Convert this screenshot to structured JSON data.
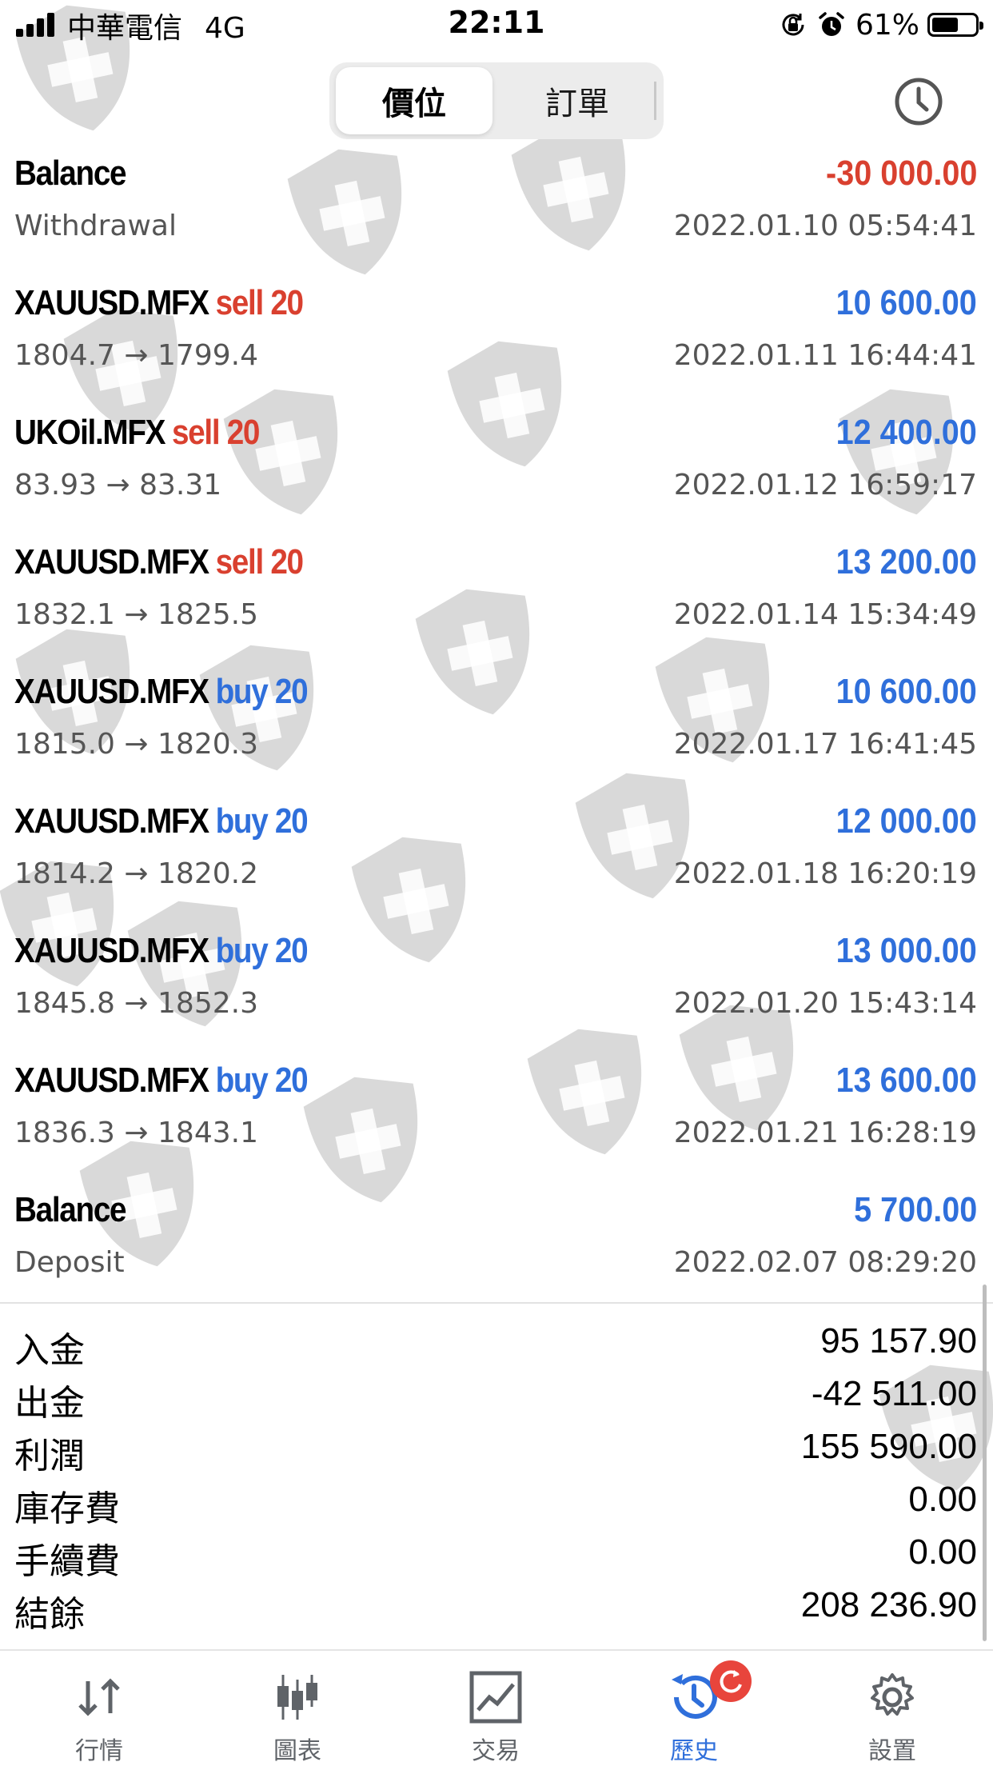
{
  "colors": {
    "loss": "#d9402f",
    "profit": "#2f6fdb",
    "neutral": "#000000"
  },
  "status_bar": {
    "carrier": "中華電信",
    "network": "4G",
    "time": "22:11",
    "battery_percent": "61%",
    "battery_level": 0.61,
    "icons": [
      "orientation-lock-icon",
      "alarm-icon"
    ]
  },
  "segment": {
    "tabs": [
      "價位",
      "訂單"
    ],
    "selected": 0
  },
  "transactions": [
    {
      "symbol": "Balance",
      "action": "",
      "amount": "-30 000.00",
      "amount_color": "loss",
      "detail": "Withdrawal",
      "time": "2022.01.10 05:54:41"
    },
    {
      "symbol": "XAUUSD.MFX",
      "action": "sell 20",
      "action_color": "loss",
      "amount": "10 600.00",
      "amount_color": "profit",
      "detail": "1804.7 → 1799.4",
      "time": "2022.01.11 16:44:41"
    },
    {
      "symbol": "UKOil.MFX",
      "action": "sell 20",
      "action_color": "loss",
      "amount": "12 400.00",
      "amount_color": "profit",
      "detail": "83.93 → 83.31",
      "time": "2022.01.12 16:59:17"
    },
    {
      "symbol": "XAUUSD.MFX",
      "action": "sell 20",
      "action_color": "loss",
      "amount": "13 200.00",
      "amount_color": "profit",
      "detail": "1832.1 → 1825.5",
      "time": "2022.01.14 15:34:49"
    },
    {
      "symbol": "XAUUSD.MFX",
      "action": "buy 20",
      "action_color": "profit",
      "amount": "10 600.00",
      "amount_color": "profit",
      "detail": "1815.0 → 1820.3",
      "time": "2022.01.17 16:41:45"
    },
    {
      "symbol": "XAUUSD.MFX",
      "action": "buy 20",
      "action_color": "profit",
      "amount": "12 000.00",
      "amount_color": "profit",
      "detail": "1814.2 → 1820.2",
      "time": "2022.01.18 16:20:19"
    },
    {
      "symbol": "XAUUSD.MFX",
      "action": "buy 20",
      "action_color": "profit",
      "amount": "13 000.00",
      "amount_color": "profit",
      "detail": "1845.8 → 1852.3",
      "time": "2022.01.20 15:43:14"
    },
    {
      "symbol": "XAUUSD.MFX",
      "action": "buy 20",
      "action_color": "profit",
      "amount": "13 600.00",
      "amount_color": "profit",
      "detail": "1836.3 → 1843.1",
      "time": "2022.01.21 16:28:19"
    },
    {
      "symbol": "Balance",
      "action": "",
      "amount": "5 700.00",
      "amount_color": "profit",
      "detail": "Deposit",
      "time": "2022.02.07 08:29:20"
    }
  ],
  "summary": [
    {
      "label": "入金",
      "value": "95 157.90"
    },
    {
      "label": "出金",
      "value": "-42 511.00"
    },
    {
      "label": "利潤",
      "value": "155 590.00"
    },
    {
      "label": "庫存費",
      "value": "0.00"
    },
    {
      "label": "手續費",
      "value": "0.00"
    },
    {
      "label": "結餘",
      "value": "208 236.90"
    }
  ],
  "tabbar": [
    {
      "label": "行情",
      "icon": "quotes-arrows-icon"
    },
    {
      "label": "圖表",
      "icon": "candlestick-chart-icon"
    },
    {
      "label": "交易",
      "icon": "trade-chart-icon"
    },
    {
      "label": "歷史",
      "icon": "history-icon",
      "active": true,
      "badge_icon": "refresh-badge-icon"
    },
    {
      "label": "設置",
      "icon": "settings-gear-icon"
    }
  ]
}
